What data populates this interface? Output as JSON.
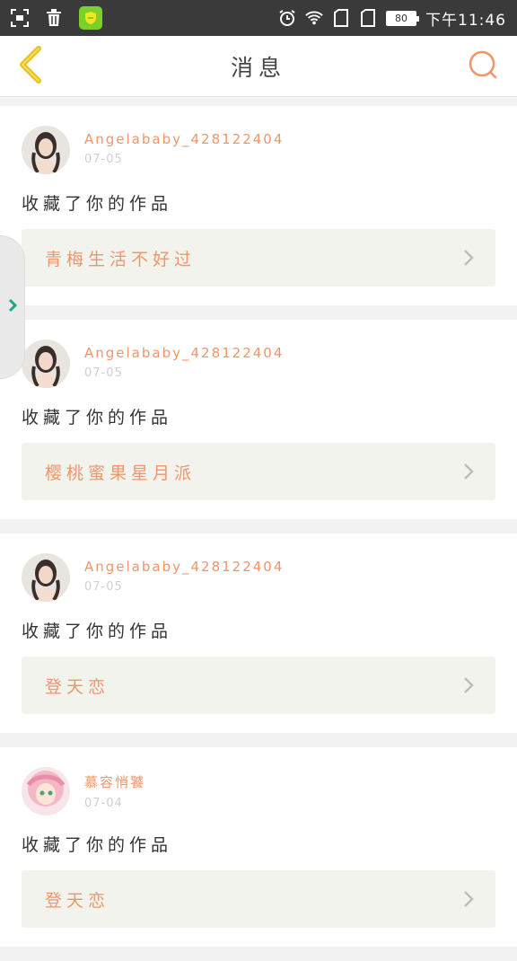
{
  "status_bar": {
    "battery": "80",
    "time": "下午11:46"
  },
  "header": {
    "title": "消息",
    "back_icon": "chevron-left-icon",
    "search_icon": "search-icon"
  },
  "colors": {
    "accent": "#f0956a",
    "back_arrow": "#e8c020",
    "date": "#cfcfcf",
    "link_bg": "#f3f3ee"
  },
  "messages": [
    {
      "username": "Angelababy_428122404",
      "date": "07-05",
      "action": "收藏了你的作品",
      "work_title": "青梅生活不好过"
    },
    {
      "username": "Angelababy_428122404",
      "date": "07-05",
      "action": "收藏了你的作品",
      "work_title": "樱桃蜜果星月派"
    },
    {
      "username": "Angelababy_428122404",
      "date": "07-05",
      "action": "收藏了你的作品",
      "work_title": "登天恋"
    },
    {
      "username": "慕容悄饕",
      "date": "07-04",
      "action": "收藏了你的作品",
      "work_title": "登天恋"
    }
  ]
}
